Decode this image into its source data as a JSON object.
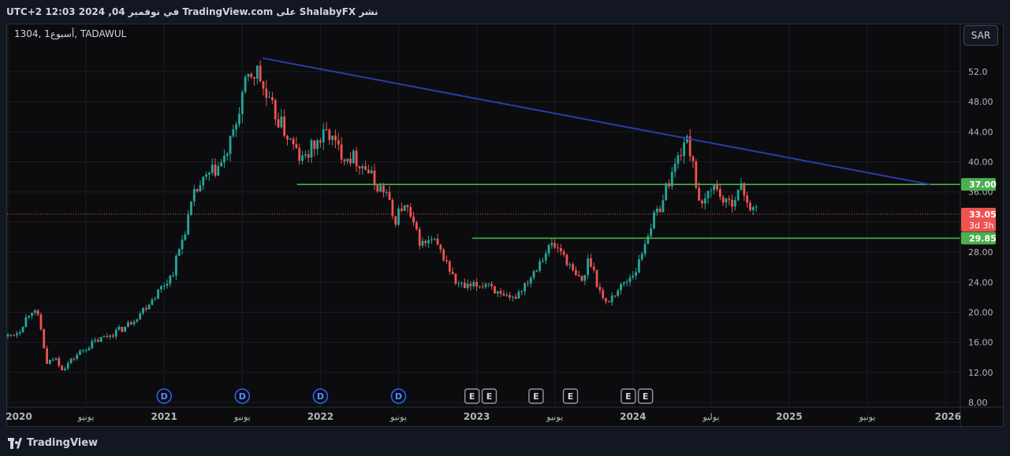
{
  "header": {
    "publish_info": "نشر ShalabyFX على TradingView.com في نوفمبر 04, 2024 12:03 UTC+2"
  },
  "symbol": {
    "label": "1304, أسبوع1, TADAWUL"
  },
  "currency_button": "SAR",
  "footer": {
    "brand": "TradingView"
  },
  "colors": {
    "up": "#26a69a",
    "down": "#ef5350",
    "trendline": "#2a3da8",
    "support": "#4caf50",
    "price_line": "#ef5350",
    "background": "#0c0c0e"
  },
  "chart_data": {
    "type": "candlestick",
    "title": "",
    "ylim": [
      7.4,
      55.2
    ],
    "y_ticks": [
      "52.0",
      "48.00",
      "44.00",
      "40.00",
      "36.00",
      "32.00",
      "28.00",
      "24.00",
      "20.00",
      "16.00",
      "12.00",
      "8.00"
    ],
    "x_ticks": [
      {
        "t": 2020.0,
        "label": "2020"
      },
      {
        "t": 2020.5,
        "label": "يونيو"
      },
      {
        "t": 2021.0,
        "label": "2021"
      },
      {
        "t": 2021.5,
        "label": "يونيو"
      },
      {
        "t": 2022.0,
        "label": "2022"
      },
      {
        "t": 2022.5,
        "label": "يونيو"
      },
      {
        "t": 2023.0,
        "label": "2023"
      },
      {
        "t": 2023.5,
        "label": "يونيو"
      },
      {
        "t": 2024.0,
        "label": "2024"
      },
      {
        "t": 2024.5,
        "label": "يوليو"
      },
      {
        "t": 2025.0,
        "label": "2025"
      },
      {
        "t": 2025.5,
        "label": "يونيو"
      },
      {
        "t": 2026.0,
        "label": "2026"
      }
    ],
    "last_price": {
      "value": "33.05",
      "countdown": "3d 3h"
    },
    "levels": [
      {
        "label": "37.00",
        "value": 37.0,
        "from": 2021.85
      },
      {
        "label": "29.85",
        "value": 29.85,
        "from": 2022.97
      }
    ],
    "trendline": {
      "from": [
        2021.63,
        53.8
      ],
      "to": [
        2025.9,
        37.0
      ]
    },
    "dividend_markers": [
      2021.0,
      2021.5,
      2022.0,
      2022.5
    ],
    "earnings_markers": [
      2022.97,
      2023.08,
      2023.38,
      2023.6,
      2023.97,
      2024.08
    ],
    "marker_labels": {
      "dividend": "D",
      "earnings": "E"
    },
    "anchors": [
      [
        2020.0,
        16.8
      ],
      [
        2020.07,
        17.5
      ],
      [
        2020.15,
        20.5
      ],
      [
        2020.2,
        19.0
      ],
      [
        2020.25,
        13.0
      ],
      [
        2020.3,
        14.0
      ],
      [
        2020.35,
        12.5
      ],
      [
        2020.45,
        14.5
      ],
      [
        2020.55,
        16.0
      ],
      [
        2020.65,
        17.0
      ],
      [
        2020.75,
        18.0
      ],
      [
        2020.85,
        20.0
      ],
      [
        2020.95,
        22.5
      ],
      [
        2021.05,
        25.0
      ],
      [
        2021.12,
        30.0
      ],
      [
        2021.2,
        36.0
      ],
      [
        2021.28,
        38.0
      ],
      [
        2021.38,
        40.0
      ],
      [
        2021.45,
        44.0
      ],
      [
        2021.5,
        49.0
      ],
      [
        2021.55,
        51.5
      ],
      [
        2021.6,
        52.0
      ],
      [
        2021.66,
        48.0
      ],
      [
        2021.72,
        46.0
      ],
      [
        2021.8,
        43.0
      ],
      [
        2021.88,
        40.0
      ],
      [
        2021.95,
        42.0
      ],
      [
        2022.05,
        44.0
      ],
      [
        2022.1,
        42.0
      ],
      [
        2022.15,
        41.0
      ],
      [
        2022.22,
        40.5
      ],
      [
        2022.3,
        39.0
      ],
      [
        2022.35,
        37.0
      ],
      [
        2022.42,
        36.0
      ],
      [
        2022.47,
        32.0
      ],
      [
        2022.52,
        34.0
      ],
      [
        2022.56,
        33.5
      ],
      [
        2022.6,
        31.0
      ],
      [
        2022.65,
        29.0
      ],
      [
        2022.72,
        29.5
      ],
      [
        2022.8,
        27.0
      ],
      [
        2022.86,
        24.0
      ],
      [
        2022.93,
        23.2
      ],
      [
        2023.0,
        23.5
      ],
      [
        2023.08,
        24.0
      ],
      [
        2023.15,
        22.0
      ],
      [
        2023.22,
        21.5
      ],
      [
        2023.28,
        23.0
      ],
      [
        2023.35,
        25.0
      ],
      [
        2023.42,
        27.5
      ],
      [
        2023.48,
        29.0
      ],
      [
        2023.55,
        28.0
      ],
      [
        2023.62,
        25.0
      ],
      [
        2023.68,
        24.0
      ],
      [
        2023.72,
        27.5
      ],
      [
        2023.77,
        24.0
      ],
      [
        2023.82,
        21.0
      ],
      [
        2023.88,
        22.5
      ],
      [
        2023.95,
        24.0
      ],
      [
        2024.03,
        26.0
      ],
      [
        2024.1,
        31.0
      ],
      [
        2024.17,
        34.0
      ],
      [
        2024.22,
        37.0
      ],
      [
        2024.28,
        40.0
      ],
      [
        2024.33,
        43.0
      ],
      [
        2024.38,
        41.0
      ],
      [
        2024.43,
        33.0
      ],
      [
        2024.5,
        37.0
      ],
      [
        2024.55,
        36.0
      ],
      [
        2024.6,
        34.0
      ],
      [
        2024.65,
        35.5
      ],
      [
        2024.7,
        36.5
      ],
      [
        2024.75,
        34.0
      ],
      [
        2024.8,
        33.05
      ]
    ]
  }
}
